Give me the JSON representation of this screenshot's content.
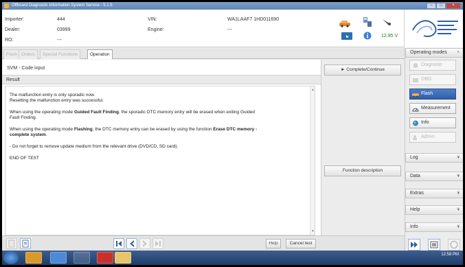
{
  "window": {
    "title": "Offboard Diagnostic Information System Service - 5.1.5",
    "buttons": [
      "–",
      "□",
      "×"
    ]
  },
  "header": {
    "importer_label": "Importer:",
    "importer_value": "444",
    "dealer_label": "Dealer:",
    "dealer_value": "03999",
    "ro_label": "RO:",
    "ro_value": "---",
    "vin_label": "VIN:",
    "vin_value": "WA1LAAF7 1HD011690",
    "engine_label": "Engine:",
    "engine_value": "---",
    "voltage": "12.95 V",
    "icons": [
      "car-icon",
      "network-icon",
      "satellite-icon",
      "battery-icon",
      "info-icon"
    ]
  },
  "tabs": [
    {
      "label": "Flash",
      "active": false
    },
    {
      "label": "Orders",
      "active": false
    },
    {
      "label": "Special Functions",
      "active": false
    },
    {
      "label": "Operation",
      "active": true
    }
  ],
  "main": {
    "title": "SVM - Code input",
    "result_label": "Result",
    "paragraphs": {
      "p1a": "The malfunction entry is only sporadic now.",
      "p1b": "Resetting the malfunction entry was successful.",
      "p2_pre": "When using the operating mode ",
      "p2_bold": "Guided Fault Finding",
      "p2_post": ", the sporadic DTC memory entry will be erased when exiting Guided",
      "p2_cont": "Fault Finding.",
      "p3_pre": "When using the operating mode ",
      "p3_bold1": "Flashing",
      "p3_mid": ", the DTC memory entry can be erased by using the function ",
      "p3_bold2": "Erase DTC memory -",
      "p3_bold3": "complete system",
      "p3_end": ".",
      "p4": "- Do not forget to remove update medium from the relevant drive (DVD/CD, SD card).",
      "p5": "END OF TEST"
    }
  },
  "actions": {
    "complete_continue": "Complete/Continue",
    "function_description": "Function description",
    "help": "Help",
    "cancel_test": "Cancel test"
  },
  "sidebar": {
    "operating_modes_label": "Operating modes",
    "modes": [
      {
        "label": "Diagnosis",
        "state": "disabled",
        "icon": "stethoscope-icon"
      },
      {
        "label": "OBD",
        "state": "disabled",
        "icon": "obd-icon"
      },
      {
        "label": "Flash",
        "state": "active",
        "icon": "flash-car-icon"
      },
      {
        "label": "Measurement",
        "state": "enabled",
        "icon": "meter-icon"
      },
      {
        "label": "Info",
        "state": "enabled",
        "icon": "info-globe-icon"
      },
      {
        "label": "Admin",
        "state": "disabled",
        "icon": "admin-icon"
      }
    ],
    "sections": [
      "Log",
      "Data",
      "Extras",
      "Help",
      "Info"
    ]
  },
  "taskbar": {
    "time": "12:58 PM"
  },
  "colors": {
    "active_mode": "#2f5ea8",
    "voltage": "#1a7a1a",
    "titlebar": "#5f86b8"
  }
}
